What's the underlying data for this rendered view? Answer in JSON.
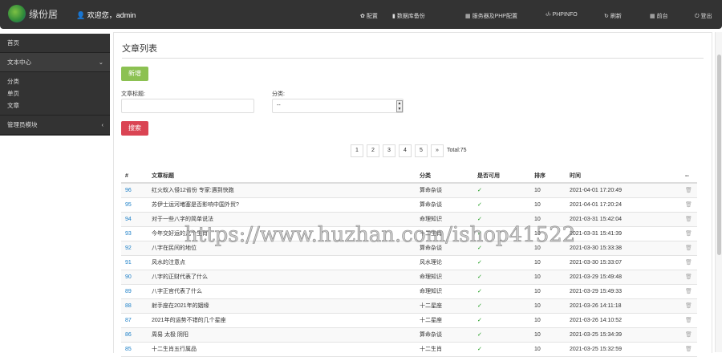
{
  "header": {
    "logo_text": "缘份居",
    "welcome": "欢迎您，admin",
    "nav": [
      {
        "label": "配置",
        "icon": "gear-icon",
        "glyph": "✿"
      },
      {
        "label": "数据库备份",
        "icon": "bookmark-icon",
        "glyph": "▮"
      },
      {
        "label": "服务器及PHP配置",
        "icon": "grid-icon",
        "glyph": "▦"
      },
      {
        "label": "PHPINFO",
        "icon": "code-icon",
        "glyph": "‹/›"
      },
      {
        "label": "刷新",
        "icon": "refresh-icon",
        "glyph": "↻"
      },
      {
        "label": "前台",
        "icon": "apps-icon",
        "glyph": "▦"
      },
      {
        "label": "登出",
        "icon": "power-icon",
        "glyph": "⏻"
      }
    ]
  },
  "sidebar": {
    "home": "首页",
    "text_center": "文本中心",
    "sub": [
      "分类",
      "单页",
      "文章"
    ],
    "admin": "管理员模块"
  },
  "main": {
    "title": "文章列表",
    "new_btn": "新增",
    "title_label": "文章标题:",
    "title_value": "",
    "cat_label": "分类:",
    "cat_value": "--",
    "search_btn": "搜索",
    "pages": [
      "1",
      "2",
      "3",
      "4",
      "5",
      "»"
    ],
    "total": "Total:75",
    "columns": [
      "#",
      "文章标题",
      "分类",
      "是否可用",
      "排序",
      "时间",
      "--"
    ],
    "rows": [
      [
        "96",
        "红火蚁入侵12省份 专家:遇到快跑",
        "算命杂谈",
        "✓",
        "10",
        "2021-04-01 17:20:49"
      ],
      [
        "95",
        "苏伊士运河堵塞是否影响中国外贸?",
        "算命杂谈",
        "✓",
        "10",
        "2021-04-01 17:20:24"
      ],
      [
        "94",
        "对于一些八字的简单说法",
        "命理知识",
        "✓",
        "10",
        "2021-03-31 15:42:04"
      ],
      [
        "93",
        "今年交好运的几个生肖",
        "十二生肖",
        "✓",
        "10",
        "2021-03-31 15:41:39"
      ],
      [
        "92",
        "八字在民间的地位",
        "算命杂谈",
        "✓",
        "10",
        "2021-03-30 15:33:38"
      ],
      [
        "91",
        "风水的注意点",
        "风水理论",
        "✓",
        "10",
        "2021-03-30 15:33:07"
      ],
      [
        "90",
        "八字的正财代表了什么",
        "命理知识",
        "✓",
        "10",
        "2021-03-29 15:49:48"
      ],
      [
        "89",
        "八字正官代表了什么",
        "命理知识",
        "✓",
        "10",
        "2021-03-29 15:49:33"
      ],
      [
        "88",
        "射手座在2021年的姻缘",
        "十二星座",
        "✓",
        "10",
        "2021-03-26 14:11:18"
      ],
      [
        "87",
        "2021年的运势不错的几个星座",
        "十二星座",
        "✓",
        "10",
        "2021-03-26 14:10:52"
      ],
      [
        "86",
        "周易 太极 阴阳",
        "算命杂谈",
        "✓",
        "10",
        "2021-03-25 15:34:39"
      ],
      [
        "85",
        "十二生肖五行属品",
        "十二生肖",
        "✓",
        "10",
        "2021-03-25 15:32:59"
      ]
    ]
  },
  "watermark": "https://www.huzhan.com/ishop41522",
  "colors": {
    "green": "#8cc152",
    "red": "#da4453",
    "link": "#1e80c8"
  }
}
